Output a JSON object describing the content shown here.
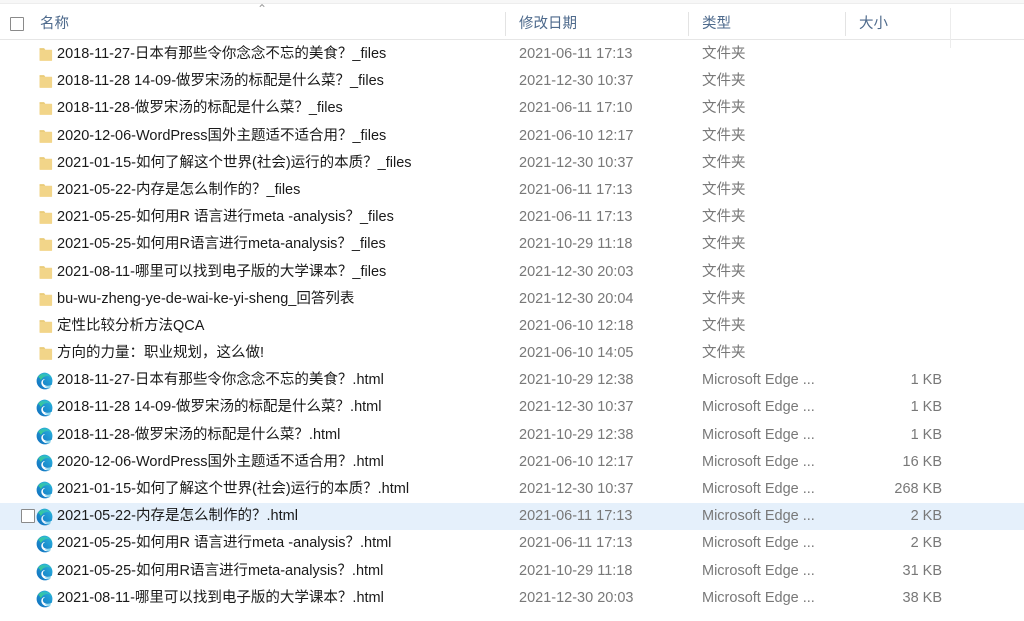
{
  "header": {
    "select_all_checkbox": "select-all",
    "sort_indicator": "⌃",
    "columns": [
      {
        "key": "name",
        "label": "名称"
      },
      {
        "key": "date",
        "label": "修改日期"
      },
      {
        "key": "type",
        "label": "类型"
      },
      {
        "key": "size",
        "label": "大小"
      }
    ]
  },
  "colors": {
    "selection": "#e5f0fb",
    "header_text": "#4e6a8c",
    "name_text": "#1a1a1a",
    "meta_text": "#787878",
    "folder_icon": "#f2d589",
    "edge_blue": "#0f6cbd",
    "edge_green": "#3dd07a",
    "edge_teal": "#2bb5e0"
  },
  "rows": [
    {
      "name": "2018-11-27-日本有那些令你念念不忘的美食？_files",
      "date": "2021-06-11 17:13",
      "type": "文件夹",
      "size": "",
      "icon": "folder-icon",
      "selected": false,
      "checkbox": false
    },
    {
      "name": "2018-11-28 14-09-做罗宋汤的标配是什么菜？_files",
      "date": "2021-12-30 10:37",
      "type": "文件夹",
      "size": "",
      "icon": "folder-icon",
      "selected": false,
      "checkbox": false
    },
    {
      "name": "2018-11-28-做罗宋汤的标配是什么菜？_files",
      "date": "2021-06-11 17:10",
      "type": "文件夹",
      "size": "",
      "icon": "folder-icon",
      "selected": false,
      "checkbox": false
    },
    {
      "name": "2020-12-06-WordPress国外主题适不适合用？_files",
      "date": "2021-06-10 12:17",
      "type": "文件夹",
      "size": "",
      "icon": "folder-icon",
      "selected": false,
      "checkbox": false
    },
    {
      "name": "2021-01-15-如何了解这个世界(社会)运行的本质？_files",
      "date": "2021-12-30 10:37",
      "type": "文件夹",
      "size": "",
      "icon": "folder-icon",
      "selected": false,
      "checkbox": false
    },
    {
      "name": "2021-05-22-内存是怎么制作的？_files",
      "date": "2021-06-11 17:13",
      "type": "文件夹",
      "size": "",
      "icon": "folder-icon",
      "selected": false,
      "checkbox": false
    },
    {
      "name": "2021-05-25-如何用R 语言进行meta -analysis？_files",
      "date": "2021-06-11 17:13",
      "type": "文件夹",
      "size": "",
      "icon": "folder-icon",
      "selected": false,
      "checkbox": false
    },
    {
      "name": "2021-05-25-如何用R语言进行meta-analysis？_files",
      "date": "2021-10-29 11:18",
      "type": "文件夹",
      "size": "",
      "icon": "folder-icon",
      "selected": false,
      "checkbox": false
    },
    {
      "name": "2021-08-11-哪里可以找到电子版的大学课本？_files",
      "date": "2021-12-30 20:03",
      "type": "文件夹",
      "size": "",
      "icon": "folder-icon",
      "selected": false,
      "checkbox": false
    },
    {
      "name": "bu-wu-zheng-ye-de-wai-ke-yi-sheng_回答列表",
      "date": "2021-12-30 20:04",
      "type": "文件夹",
      "size": "",
      "icon": "folder-icon",
      "selected": false,
      "checkbox": false
    },
    {
      "name": "定性比较分析方法QCA",
      "date": "2021-06-10 12:18",
      "type": "文件夹",
      "size": "",
      "icon": "folder-icon",
      "selected": false,
      "checkbox": false
    },
    {
      "name": "方向的力量：职业规划，这么做!",
      "date": "2021-06-10 14:05",
      "type": "文件夹",
      "size": "",
      "icon": "folder-icon",
      "selected": false,
      "checkbox": false
    },
    {
      "name": "2018-11-27-日本有那些令你念念不忘的美食？.html",
      "date": "2021-10-29 12:38",
      "type": "Microsoft Edge ...",
      "size": "1 KB",
      "icon": "edge-icon",
      "selected": false,
      "checkbox": false
    },
    {
      "name": "2018-11-28 14-09-做罗宋汤的标配是什么菜？.html",
      "date": "2021-12-30 10:37",
      "type": "Microsoft Edge ...",
      "size": "1 KB",
      "icon": "edge-icon",
      "selected": false,
      "checkbox": false
    },
    {
      "name": "2018-11-28-做罗宋汤的标配是什么菜？.html",
      "date": "2021-10-29 12:38",
      "type": "Microsoft Edge ...",
      "size": "1 KB",
      "icon": "edge-icon",
      "selected": false,
      "checkbox": false
    },
    {
      "name": "2020-12-06-WordPress国外主题适不适合用？.html",
      "date": "2021-06-10 12:17",
      "type": "Microsoft Edge ...",
      "size": "16 KB",
      "icon": "edge-icon",
      "selected": false,
      "checkbox": false
    },
    {
      "name": "2021-01-15-如何了解这个世界(社会)运行的本质？.html",
      "date": "2021-12-30 10:37",
      "type": "Microsoft Edge ...",
      "size": "268 KB",
      "icon": "edge-icon",
      "selected": false,
      "checkbox": false
    },
    {
      "name": "2021-05-22-内存是怎么制作的？.html",
      "date": "2021-06-11 17:13",
      "type": "Microsoft Edge ...",
      "size": "2 KB",
      "icon": "edge-icon",
      "selected": true,
      "checkbox": true
    },
    {
      "name": "2021-05-25-如何用R 语言进行meta -analysis？.html",
      "date": "2021-06-11 17:13",
      "type": "Microsoft Edge ...",
      "size": "2 KB",
      "icon": "edge-icon",
      "selected": false,
      "checkbox": false
    },
    {
      "name": "2021-05-25-如何用R语言进行meta-analysis？.html",
      "date": "2021-10-29 11:18",
      "type": "Microsoft Edge ...",
      "size": "31 KB",
      "icon": "edge-icon",
      "selected": false,
      "checkbox": false
    },
    {
      "name": "2021-08-11-哪里可以找到电子版的大学课本？.html",
      "date": "2021-12-30 20:03",
      "type": "Microsoft Edge ...",
      "size": "38 KB",
      "icon": "edge-icon",
      "selected": false,
      "checkbox": false
    }
  ]
}
